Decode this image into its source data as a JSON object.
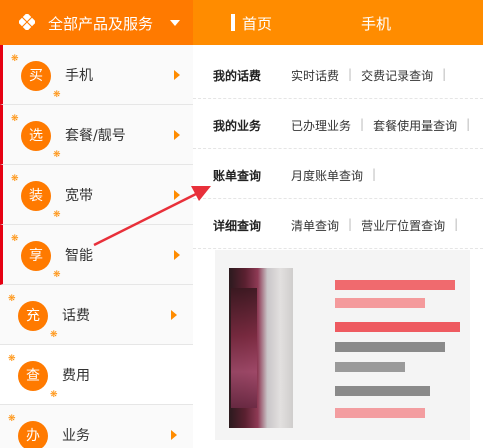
{
  "header": {
    "category_label": "全部产品及服务",
    "nav": [
      {
        "label": "首页"
      },
      {
        "label": "手机"
      }
    ]
  },
  "sidebar": {
    "items": [
      {
        "badge": "买",
        "label": "手机"
      },
      {
        "badge": "选",
        "label": "套餐/靓号"
      },
      {
        "badge": "装",
        "label": "宽带"
      },
      {
        "badge": "享",
        "label": "智能"
      },
      {
        "badge": "充",
        "label": "话费"
      },
      {
        "badge": "查",
        "label": "费用"
      },
      {
        "badge": "办",
        "label": "业务"
      }
    ]
  },
  "services": [
    {
      "title": "我的话费",
      "links": [
        "实时话费",
        "交费记录查询"
      ]
    },
    {
      "title": "我的业务",
      "links": [
        "已办理业务",
        "套餐使用量查询"
      ]
    },
    {
      "title": "账单查询",
      "links": [
        "月度账单查询"
      ]
    },
    {
      "title": "详细查询",
      "links": [
        "清单查询",
        "营业厅位置查询"
      ]
    }
  ],
  "colors": {
    "accent": "#ff8c00",
    "accent_dark": "#ff7a00",
    "annotation_arrow": "#e8303a"
  }
}
